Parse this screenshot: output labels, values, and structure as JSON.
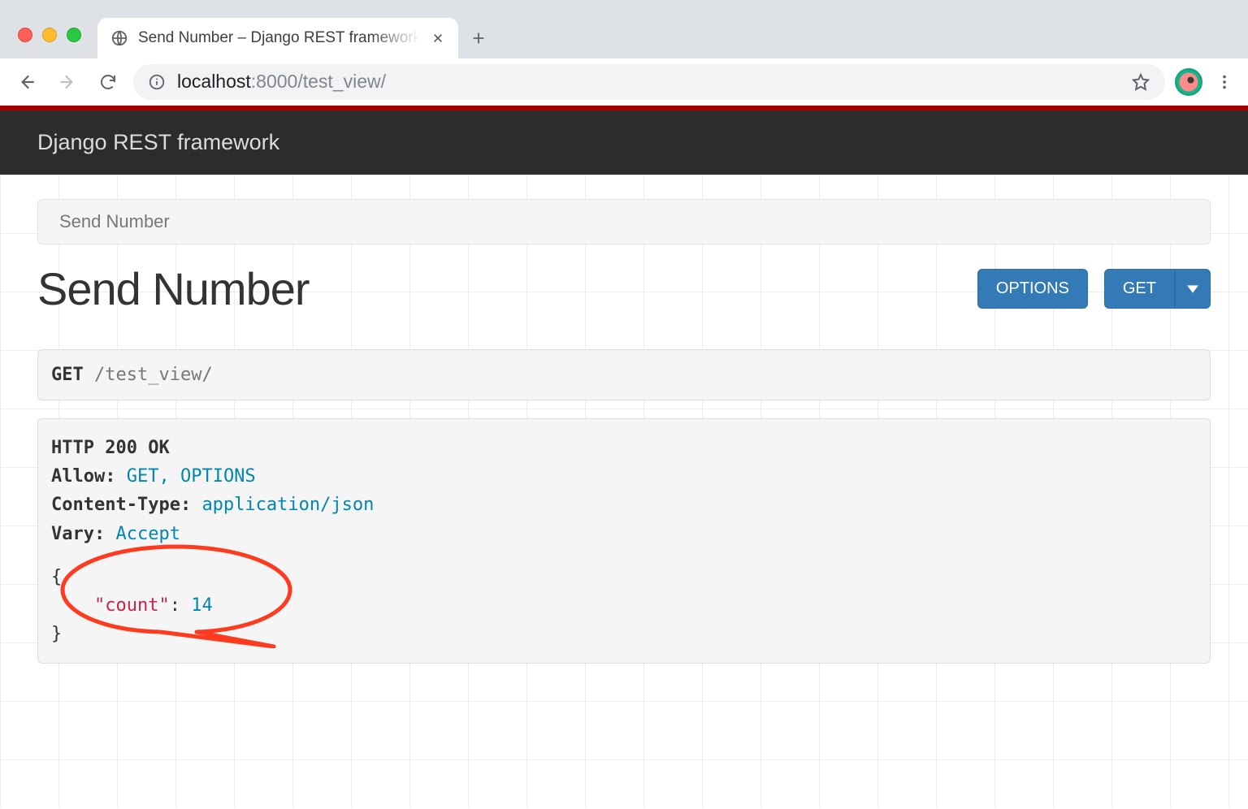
{
  "browser": {
    "tab_title": "Send Number – Django REST framework",
    "url_host": "localhost",
    "url_port": ":8000",
    "url_path": "/test_view/"
  },
  "navbar": {
    "brand": "Django REST framework"
  },
  "breadcrumb": {
    "current": "Send Number"
  },
  "page": {
    "title": "Send Number"
  },
  "buttons": {
    "options": "OPTIONS",
    "get": "GET"
  },
  "request": {
    "method": "GET",
    "path": "/test_view/"
  },
  "response": {
    "status_line": "HTTP 200 OK",
    "headers": {
      "allow_k": "Allow:",
      "allow_v": "GET, OPTIONS",
      "ctype_k": "Content-Type:",
      "ctype_v": "application/json",
      "vary_k": "Vary:",
      "vary_v": "Accept"
    },
    "body": {
      "open": "{",
      "key": "\"count\"",
      "sep": ":",
      "value": "14",
      "close": "}"
    }
  }
}
